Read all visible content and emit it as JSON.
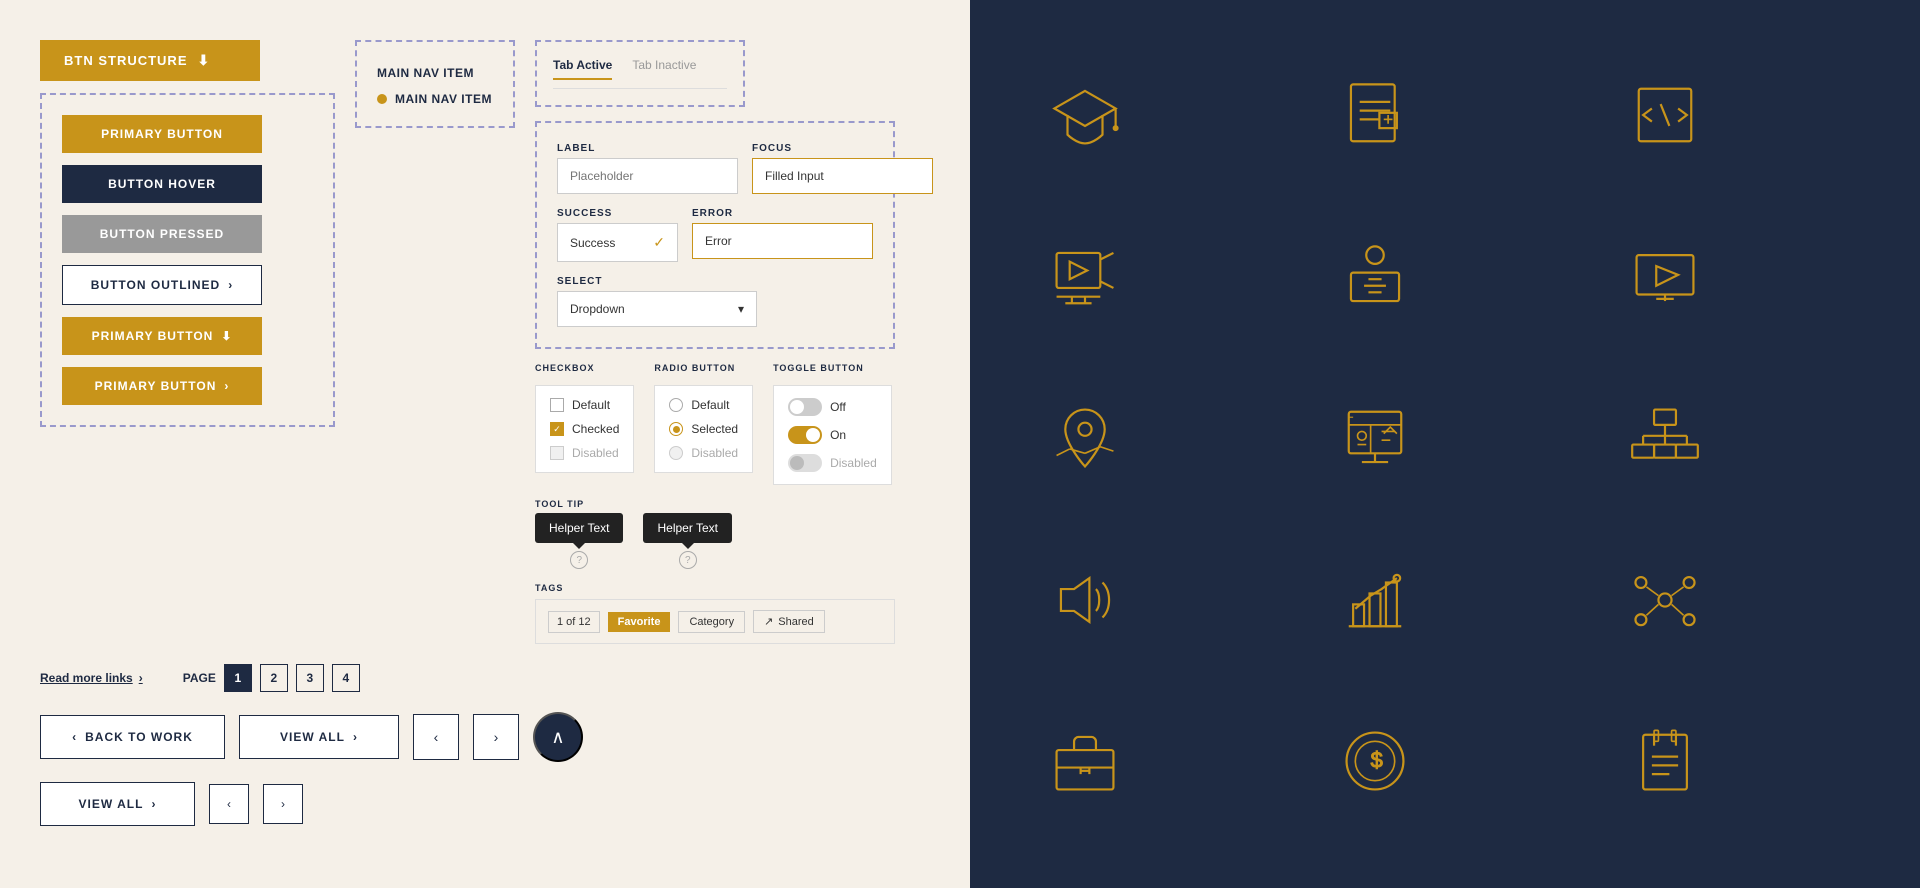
{
  "buttons": {
    "btn_structure": "BTN STRUCTURE",
    "primary_button": "PRIMARY BUTTON",
    "button_hover": "BUTTON HOVER",
    "button_pressed": "BUTTON PRESSED",
    "button_outlined": "BUTTON OUTLINED",
    "primary_button_icon": "PRIMARY BUTTON",
    "primary_button_arrow": "PRIMARY BUTTON"
  },
  "nav": {
    "item1": "MAIN NAV ITEM",
    "item2": "MAIN NAV ITEM"
  },
  "tabs": {
    "active": "Tab Active",
    "inactive": "Tab Inactive"
  },
  "form": {
    "label_label": "LABEL",
    "label_focus": "FOCUS",
    "label_success": "SUCCESS",
    "label_error": "ERROR",
    "placeholder": "Placeholder",
    "filled_input": "Filled Input",
    "success_value": "Success",
    "error_value": "Error"
  },
  "select": {
    "label": "SELECT",
    "dropdown_value": "Dropdown"
  },
  "checkbox": {
    "group_label": "CHECKBOX",
    "default": "Default",
    "checked": "Checked",
    "disabled": "Disabled"
  },
  "radio": {
    "group_label": "RADIO BUTTON",
    "default": "Default",
    "selected": "Selected",
    "disabled": "Disabled"
  },
  "toggle": {
    "group_label": "TOGGLE BUTTON",
    "off": "Off",
    "on": "On",
    "disabled": "Disabled"
  },
  "tooltip": {
    "label": "TOOL TIP",
    "helper_text1": "Helper Text",
    "helper_text2": "Helper Text"
  },
  "tags": {
    "label": "TAGS",
    "count": "1 of 12",
    "favorite": "Favorite",
    "category": "Category",
    "shared": "Shared"
  },
  "pagination": {
    "label": "PAGE",
    "pages": [
      "1",
      "2",
      "3",
      "4"
    ]
  },
  "links": {
    "read_more": "Read more links"
  },
  "nav_buttons": {
    "back_to_work": "BACK TO WORK",
    "view_all": "VIEW ALL",
    "view_all2": "VIEW ALL"
  },
  "icons": {
    "graduation": "graduation-cap",
    "document": "document-text",
    "code": "code-brackets",
    "video_play": "video-play",
    "presenter": "presenter-screen",
    "video_screen": "video-screen",
    "location_map": "location-map",
    "strategy": "strategy-board",
    "hierarchy": "org-hierarchy",
    "audio": "audio-speaker",
    "chart": "bar-chart-up",
    "network": "network-nodes",
    "briefcase": "briefcase",
    "money": "money-coin",
    "notepad": "notepad-list"
  },
  "colors": {
    "gold": "#c8941a",
    "dark_navy": "#1e2a42",
    "light_bg": "#f5f0e8",
    "dashed_border": "#9999cc"
  }
}
